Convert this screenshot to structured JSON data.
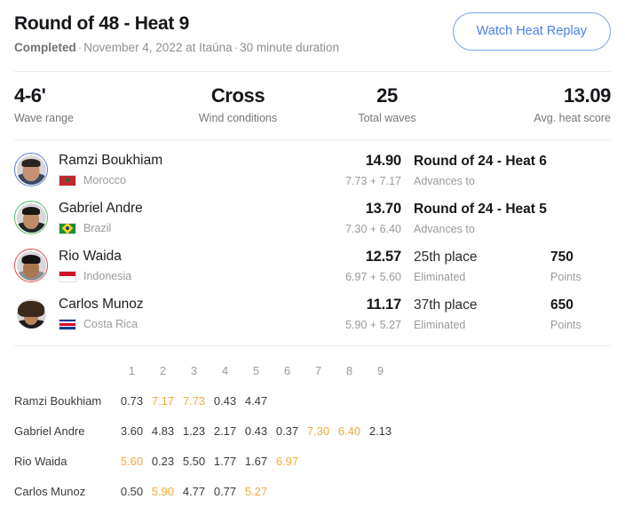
{
  "header": {
    "title": "Round of 48 - Heat 9",
    "status": "Completed",
    "date": "November 4, 2022 at Itaúna",
    "duration": "30 minute duration",
    "separator": "·",
    "replay_button": "Watch Heat Replay"
  },
  "stats": [
    {
      "value": "4-6'",
      "label": "Wave range"
    },
    {
      "value": "Cross",
      "label": "Wind conditions"
    },
    {
      "value": "25",
      "label": "Total waves"
    },
    {
      "value": "13.09",
      "label": "Avg. heat score"
    }
  ],
  "athletes": [
    {
      "name": "Ramzi Boukhiam",
      "country": "Morocco",
      "flag": "morocco-flag",
      "ring_color": "#5b7fd4",
      "total": "14.90",
      "parts": "7.73 + 7.17",
      "result": "Round of 24 - Heat 6",
      "result_sub": "Advances to",
      "points": "",
      "points_label": ""
    },
    {
      "name": "Gabriel Andre",
      "country": "Brazil",
      "flag": "brazil-flag",
      "ring_color": "#58b96a",
      "total": "13.70",
      "parts": "7.30 + 6.40",
      "result": "Round of 24 - Heat 5",
      "result_sub": "Advances to",
      "points": "",
      "points_label": ""
    },
    {
      "name": "Rio Waida",
      "country": "Indonesia",
      "flag": "indonesia-flag",
      "ring_color": "#e0484f",
      "total": "12.57",
      "parts": "6.97 + 5.60",
      "result": "25th place",
      "result_sub": "Eliminated",
      "points": "750",
      "points_label": "Points"
    },
    {
      "name": "Carlos Munoz",
      "country": "Costa Rica",
      "flag": "costarica-flag",
      "ring_color": "transparent",
      "total": "11.17",
      "parts": "5.90 + 5.27",
      "result": "37th place",
      "result_sub": "Eliminated",
      "points": "650",
      "points_label": "Points"
    }
  ],
  "wave_table": {
    "columns": [
      "1",
      "2",
      "3",
      "4",
      "5",
      "6",
      "7",
      "8",
      "9"
    ],
    "rows": [
      {
        "name": "Ramzi Boukhiam",
        "scores": [
          "0.73",
          "7.17",
          "7.73",
          "0.43",
          "4.47",
          "",
          "",
          "",
          ""
        ],
        "highlight": [
          false,
          true,
          true,
          false,
          false,
          false,
          false,
          false,
          false
        ]
      },
      {
        "name": "Gabriel Andre",
        "scores": [
          "3.60",
          "4.83",
          "1.23",
          "2.17",
          "0.43",
          "0.37",
          "7.30",
          "6.40",
          "2.13"
        ],
        "highlight": [
          false,
          false,
          false,
          false,
          false,
          false,
          true,
          true,
          false
        ]
      },
      {
        "name": "Rio Waida",
        "scores": [
          "5.60",
          "0.23",
          "5.50",
          "1.77",
          "1.67",
          "6.97",
          "",
          "",
          ""
        ],
        "highlight": [
          true,
          false,
          false,
          false,
          false,
          true,
          false,
          false,
          false
        ]
      },
      {
        "name": "Carlos Munoz",
        "scores": [
          "0.50",
          "5.90",
          "4.77",
          "0.77",
          "5.27",
          "",
          "",
          "",
          ""
        ],
        "highlight": [
          false,
          true,
          false,
          false,
          true,
          false,
          false,
          false,
          false
        ]
      }
    ]
  },
  "colors": {
    "accent_blue": "#4a7fe8",
    "highlight_orange": "#f2a93b",
    "divider": "#ececee"
  }
}
